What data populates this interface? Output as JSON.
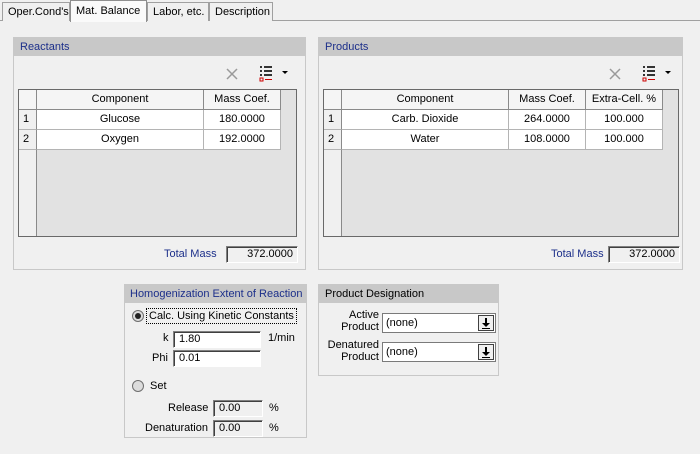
{
  "tabs": [
    "Oper.Cond's",
    "Mat. Balance",
    "Labor, etc.",
    "Description"
  ],
  "reactants": {
    "title": "Reactants",
    "columns": [
      "Component",
      "Mass Coef."
    ],
    "rows": [
      {
        "num": "1",
        "component": "Glucose",
        "mass": "180.0000"
      },
      {
        "num": "2",
        "component": "Oxygen",
        "mass": "192.0000"
      }
    ],
    "total_label": "Total Mass",
    "total_value": "372.0000"
  },
  "products": {
    "title": "Products",
    "columns": [
      "Component",
      "Mass Coef.",
      "Extra-Cell. %"
    ],
    "rows": [
      {
        "num": "1",
        "component": "Carb. Dioxide",
        "mass": "264.0000",
        "extra": "100.000"
      },
      {
        "num": "2",
        "component": "Water",
        "mass": "108.0000",
        "extra": "100.000"
      }
    ],
    "total_label": "Total Mass",
    "total_value": "372.0000"
  },
  "homogenization": {
    "title": "Homogenization Extent of Reaction",
    "calc_label": "Calc. Using Kinetic Constants",
    "k_label": "k",
    "k_value": "1.80",
    "k_unit": "1/min",
    "phi_label": "Phi",
    "phi_value": "0.01",
    "set_label": "Set",
    "release_label": "Release",
    "release_value": "0.00",
    "denaturation_label": "Denaturation",
    "denaturation_value": "0.00",
    "percent": "%"
  },
  "designation": {
    "title": "Product Designation",
    "active_label_1": "Active",
    "active_label_2": "Product",
    "active_value": "(none)",
    "denatured_label_1": "Denatured",
    "denatured_label_2": "Product",
    "denatured_value": "(none)"
  },
  "icons": [
    "delete-x-icon",
    "list-options-icon",
    "dropdown-arrow-icon",
    "down-arrow-icon"
  ]
}
